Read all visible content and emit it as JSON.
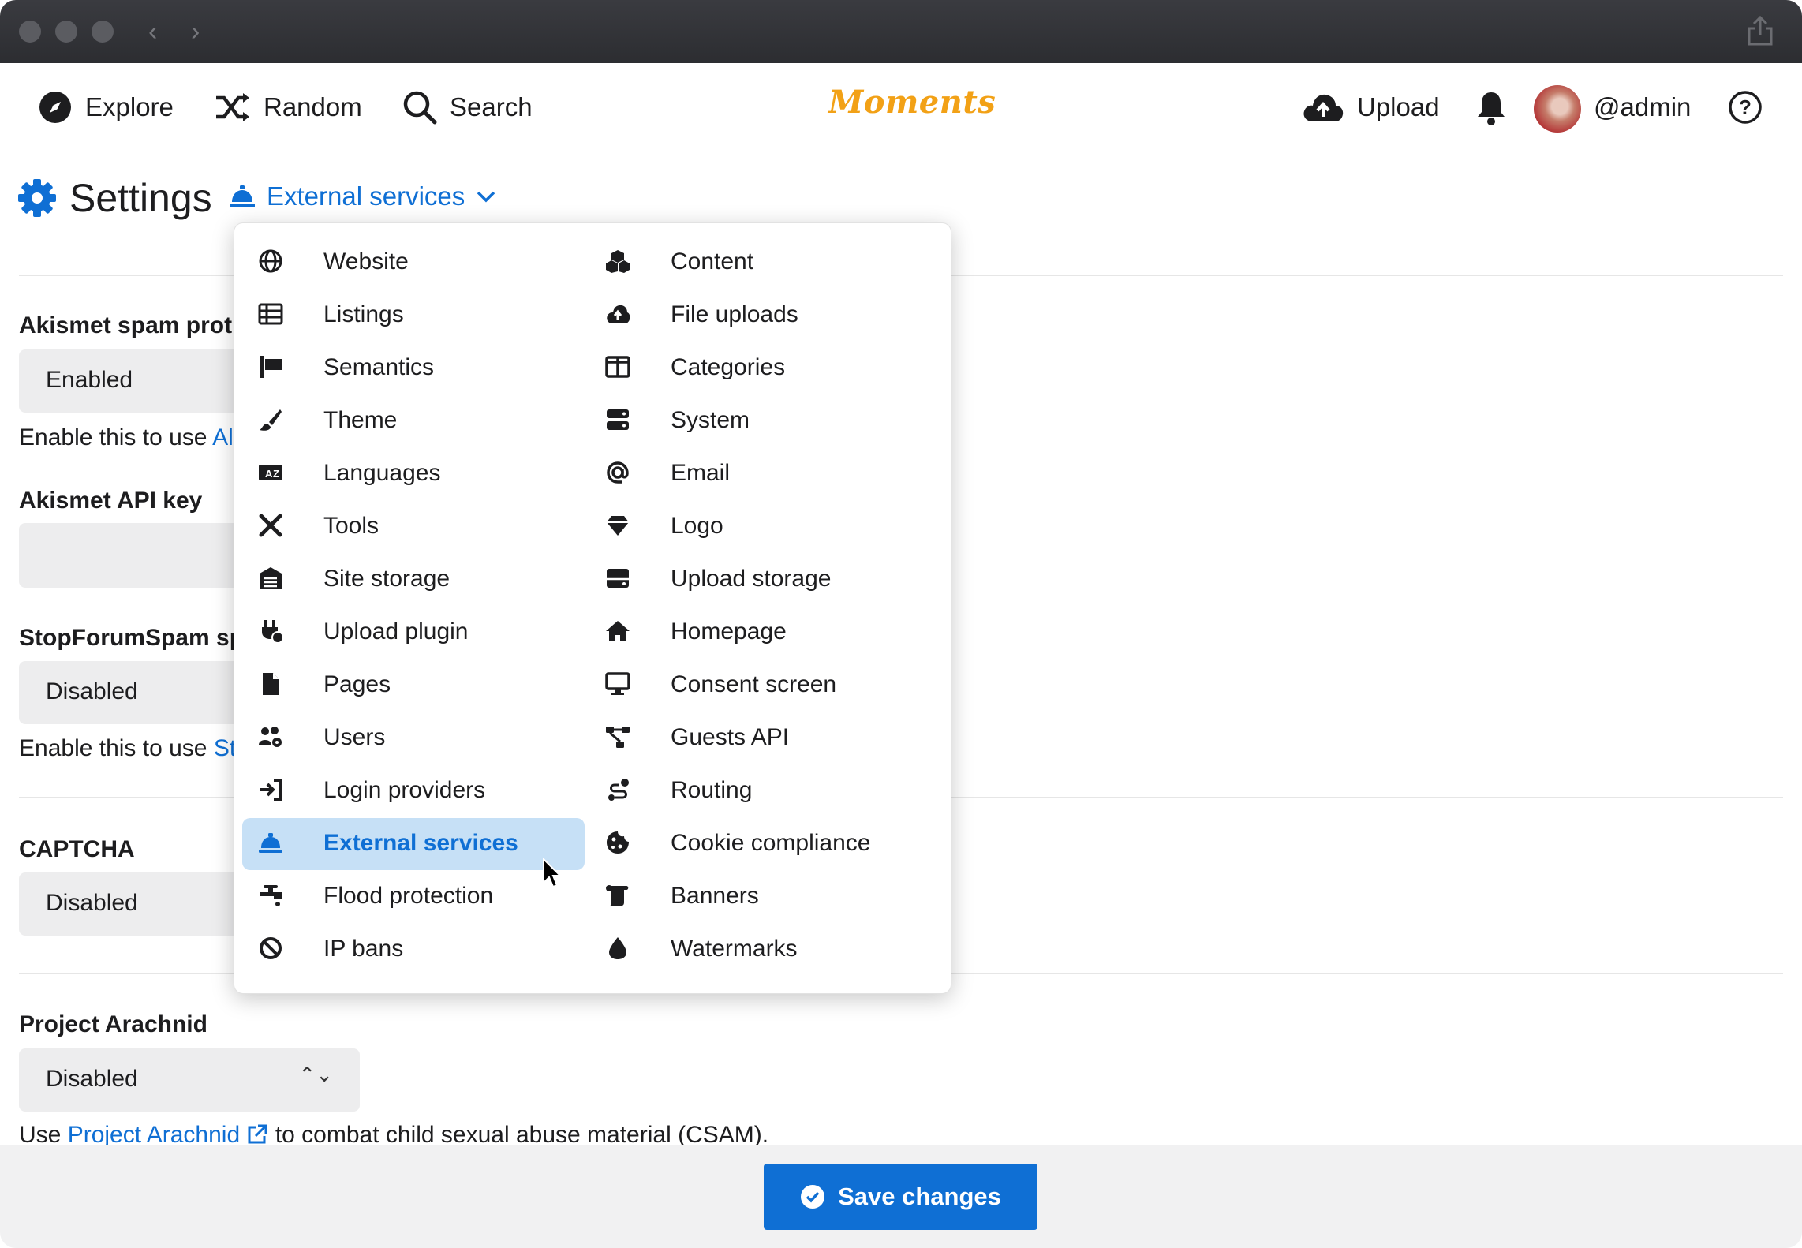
{
  "nav": {
    "explore": "Explore",
    "random": "Random",
    "search": "Search",
    "logo": "Moments",
    "upload": "Upload",
    "username": "@admin"
  },
  "settings": {
    "title": "Settings",
    "section": "External services"
  },
  "form": {
    "akismet_label": "Akismet spam prot",
    "akismet_value": "Enabled",
    "akismet_help": "Enable this to use ",
    "akismet_help_link": "Al",
    "akismet_key_label": "Akismet API key",
    "sfs_label": "StopForumSpam sp",
    "sfs_value": "Disabled",
    "sfs_help": "Enable this to use ",
    "sfs_help_link": "St",
    "captcha_label": "CAPTCHA",
    "captcha_value": "Disabled",
    "arachnid_label": "Project Arachnid",
    "arachnid_value": "Disabled",
    "arachnid_help_pre": "Use ",
    "arachnid_help_link": "Project Arachnid",
    "arachnid_help_post": " to combat child sexual abuse material (CSAM)."
  },
  "menu": {
    "left": [
      {
        "label": "Website",
        "icon": "globe-icon"
      },
      {
        "label": "Listings",
        "icon": "table-list-icon"
      },
      {
        "label": "Semantics",
        "icon": "flag-icon"
      },
      {
        "label": "Theme",
        "icon": "paintbrush-icon"
      },
      {
        "label": "Languages",
        "icon": "language-icon"
      },
      {
        "label": "Tools",
        "icon": "tools-icon"
      },
      {
        "label": "Site storage",
        "icon": "warehouse-icon"
      },
      {
        "label": "Upload plugin",
        "icon": "plug-icon"
      },
      {
        "label": "Pages",
        "icon": "file-icon"
      },
      {
        "label": "Users",
        "icon": "users-gear-icon"
      },
      {
        "label": "Login providers",
        "icon": "sign-in-icon"
      },
      {
        "label": "External services",
        "icon": "bell-concierge-icon",
        "active": true
      },
      {
        "label": "Flood protection",
        "icon": "faucet-icon"
      },
      {
        "label": "IP bans",
        "icon": "ban-icon"
      }
    ],
    "right": [
      {
        "label": "Content",
        "icon": "cubes-icon"
      },
      {
        "label": "File uploads",
        "icon": "cloud-upload-icon"
      },
      {
        "label": "Categories",
        "icon": "columns-icon"
      },
      {
        "label": "System",
        "icon": "server-icon"
      },
      {
        "label": "Email",
        "icon": "at-icon"
      },
      {
        "label": "Logo",
        "icon": "gem-icon"
      },
      {
        "label": "Upload storage",
        "icon": "hdd-icon"
      },
      {
        "label": "Homepage",
        "icon": "home-icon"
      },
      {
        "label": "Consent screen",
        "icon": "desktop-icon"
      },
      {
        "label": "Guests API",
        "icon": "diagram-icon"
      },
      {
        "label": "Routing",
        "icon": "route-icon"
      },
      {
        "label": "Cookie compliance",
        "icon": "cookie-icon"
      },
      {
        "label": "Banners",
        "icon": "scroll-icon"
      },
      {
        "label": "Watermarks",
        "icon": "droplet-icon"
      }
    ]
  },
  "footer": {
    "save_label": "Save changes"
  },
  "colors": {
    "accent": "#0f6fd4",
    "logo": "#f2a116",
    "active_bg": "#c6e0f6"
  }
}
